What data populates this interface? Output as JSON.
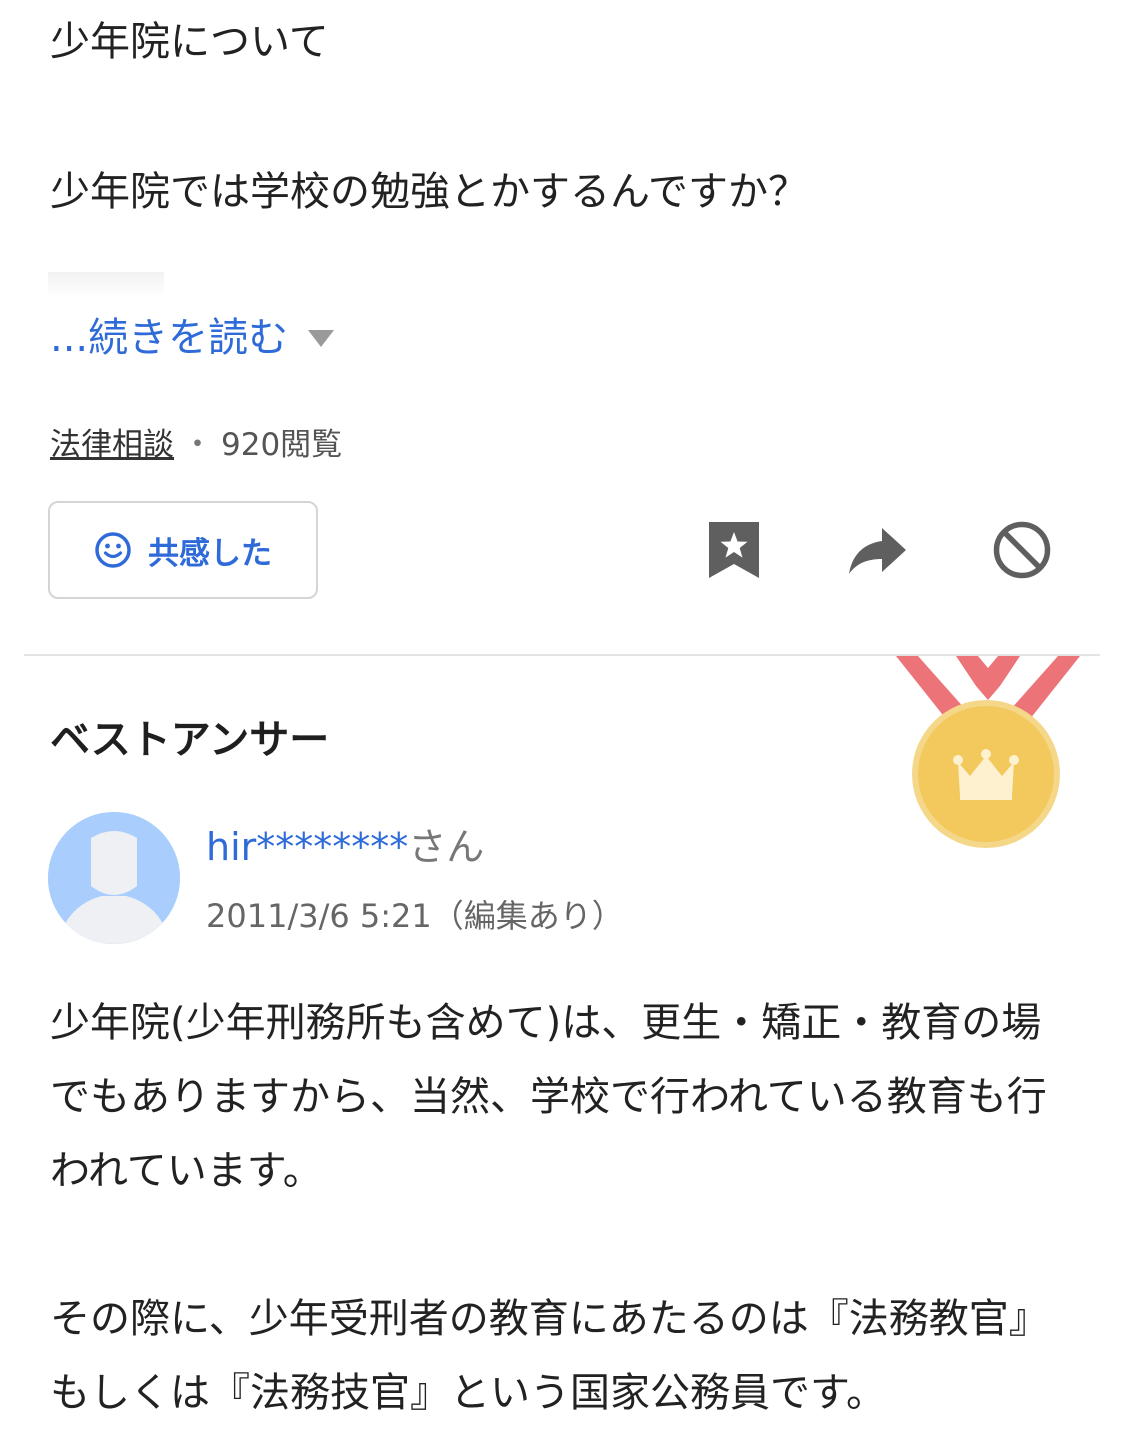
{
  "question": {
    "title": "少年院について",
    "body": "少年院では学校の勉強とかするんですか？",
    "read_more": "...続きを読む",
    "category": "法律相談",
    "separator": "・",
    "views": "920閲覧"
  },
  "actions": {
    "empathy_label": "共感した",
    "icons": [
      "smile-icon",
      "bookmark-star-icon",
      "share-arrow-icon",
      "block-icon"
    ]
  },
  "best_answer": {
    "heading": "ベストアンサー",
    "medal_icon": "crown-medal-icon",
    "user_name": "hir********",
    "user_suffix": "さん",
    "date": "2011/3/6 5:21（編集あり）",
    "paragraph1": "少年院(少年刑務所も含めて)は、更生・矯正・教育の場でもありますから、当然、学校で行われている教育も行われています。",
    "paragraph2": "その際に、少年受刑者の教育にあたるのは『法務教官』もしくは『法務技官』という国家公務員です。"
  },
  "colors": {
    "link_blue": "#2f6bd8",
    "medal_gold": "#f3c85c",
    "ribbon_red": "#ec7478",
    "avatar_bg": "#a9cdfd",
    "icon_gray": "#5f5f5f"
  }
}
